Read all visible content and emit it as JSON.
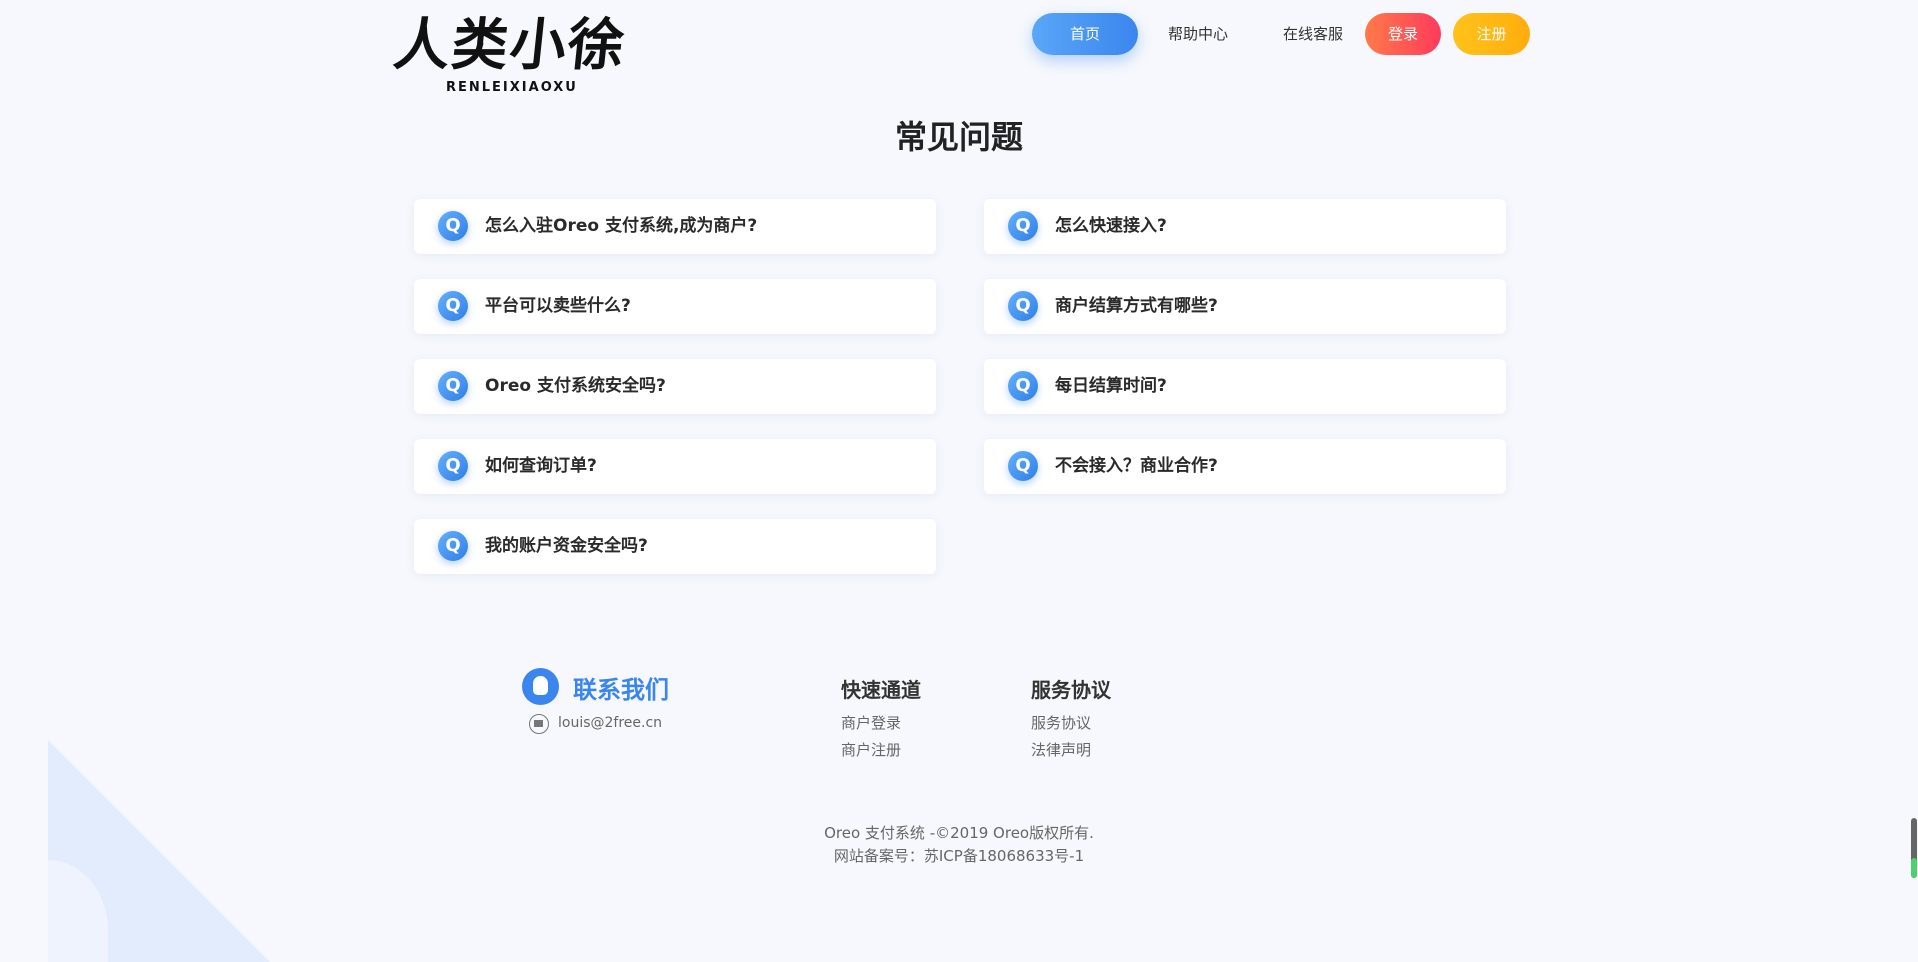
{
  "header": {
    "logo_main": "人类小徐",
    "logo_sub": "RENLEIXIAOXU",
    "nav": {
      "home": "首页",
      "help": "帮助中心",
      "service": "在线客服",
      "login": "登录",
      "register": "注册"
    }
  },
  "faq": {
    "title": "常见问题",
    "badge": "Q",
    "items": [
      "怎么入驻Oreo 支付系统,成为商户?",
      "怎么快速接入?",
      "平台可以卖些什么?",
      "商户结算方式有哪些?",
      "Oreo 支付系统安全吗?",
      "每日结算时间?",
      "如何查询订单?",
      "不会接入？商业合作?",
      "我的账户资金安全吗?"
    ]
  },
  "footer": {
    "contact_title": "联系我们",
    "email": "louis@2free.cn",
    "quick_title": "快速通道",
    "quick_links": [
      "商户登录",
      "商户注册"
    ],
    "service_title": "服务协议",
    "service_links": [
      "服务协议",
      "法律声明"
    ],
    "copyright": "Oreo 支付系统 -©2019 Oreo版权所有.",
    "icp": "网站备案号：苏ICP备18068633号-1"
  },
  "colors": {
    "accent_blue": "#3a86ee",
    "login_red": "#ff3b5c",
    "register_yellow": "#ffb40f",
    "background": "#f6f8fd"
  }
}
